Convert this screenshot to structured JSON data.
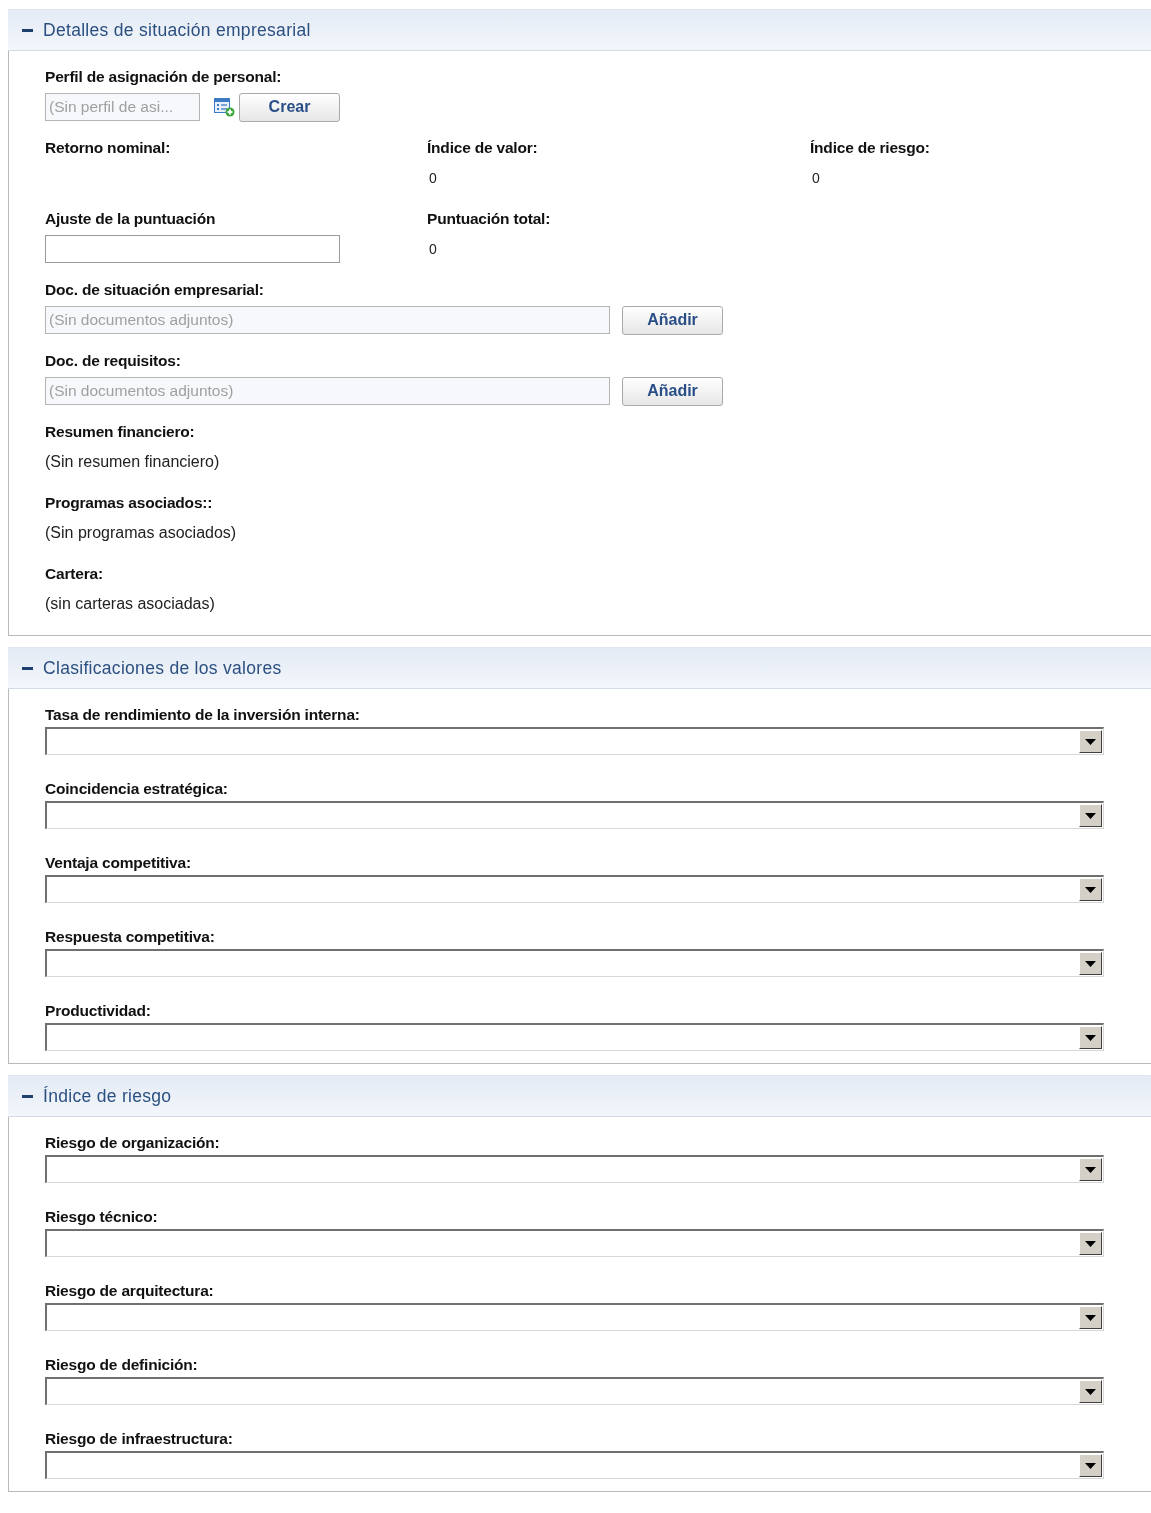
{
  "sections": [
    {
      "kind": "details",
      "title": "Detalles de situación empresarial",
      "expanded": true,
      "staffing_profile": {
        "label": "Perfil de asignación de personal:",
        "placeholder": "(Sin perfil de asi...",
        "button": "Crear"
      },
      "metrics": [
        {
          "kind": "value",
          "label": "Retorno nominal:"
        },
        {
          "kind": "value",
          "label": "Índice de valor:",
          "value": "0"
        },
        {
          "kind": "value",
          "label": "Índice de riesgo:",
          "value": "0"
        },
        {
          "kind": "input",
          "label": "Ajuste de la puntuación"
        },
        {
          "kind": "value",
          "label": "Puntuación total:",
          "value": "0"
        }
      ],
      "documents": [
        {
          "label": "Doc. de situación empresarial:",
          "placeholder": "(Sin documentos adjuntos)",
          "button": "Añadir"
        },
        {
          "label": "Doc. de requisitos:",
          "placeholder": "(Sin documentos adjuntos)",
          "button": "Añadir"
        }
      ],
      "associations": [
        {
          "label": "Resumen financiero:",
          "text": "(Sin resumen financiero)"
        },
        {
          "label": "Programas asociados::",
          "text": "(Sin programas asociados)"
        },
        {
          "label": "Cartera:",
          "text": "(sin carteras asociadas)"
        }
      ]
    },
    {
      "kind": "selects",
      "title": "Clasificaciones de los valores",
      "expanded": true,
      "fields": [
        {
          "label": "Tasa de rendimiento de la inversión interna:"
        },
        {
          "label": "Coincidencia estratégica:"
        },
        {
          "label": "Ventaja competitiva:"
        },
        {
          "label": "Respuesta competitiva:"
        },
        {
          "label": "Productividad:"
        }
      ]
    },
    {
      "kind": "selects",
      "title": "Índice de riesgo",
      "expanded": true,
      "fields": [
        {
          "label": "Riesgo de organización:"
        },
        {
          "label": "Riesgo técnico:"
        },
        {
          "label": "Riesgo de arquitectura:"
        },
        {
          "label": "Riesgo de definición:"
        },
        {
          "label": "Riesgo de infraestructura:"
        }
      ]
    }
  ]
}
